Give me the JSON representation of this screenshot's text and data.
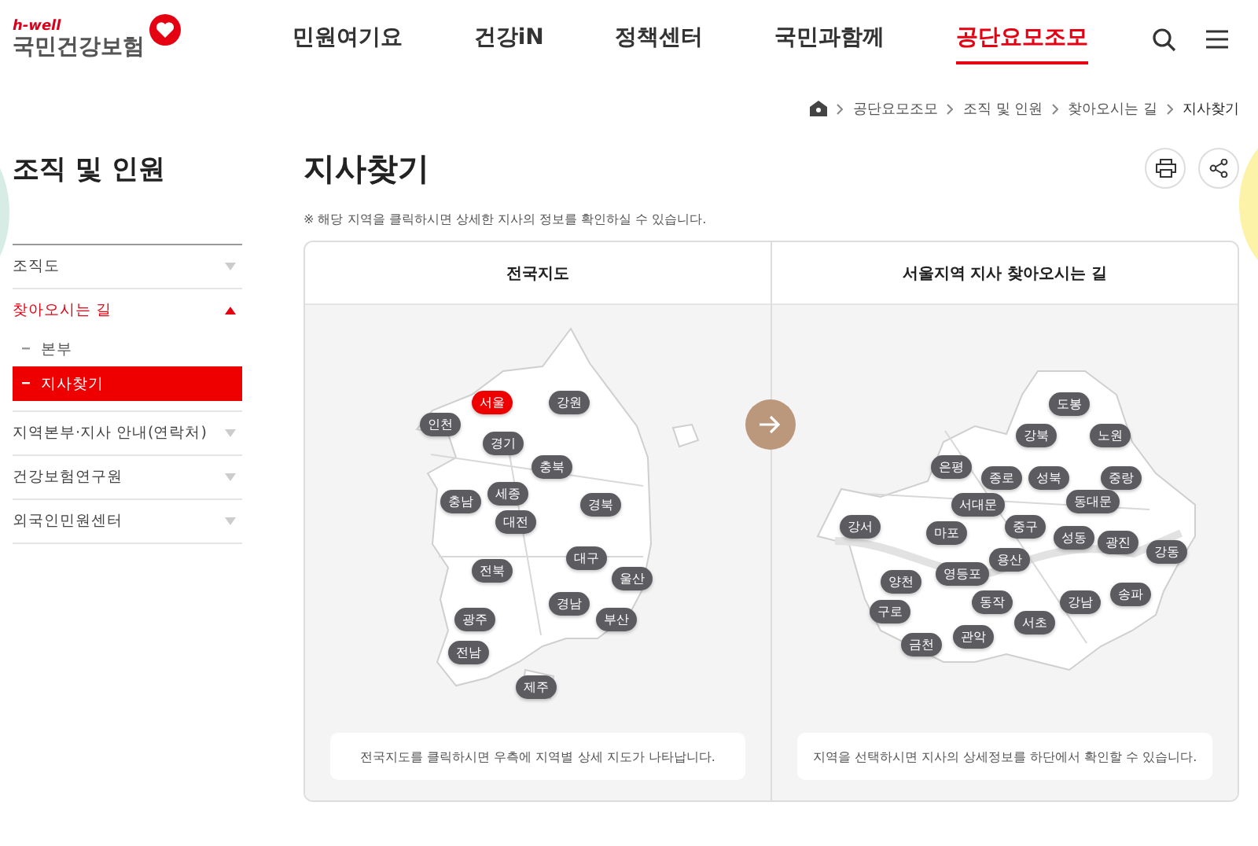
{
  "logo": {
    "tagline": "h-well",
    "name": "국민건강보험"
  },
  "nav": [
    {
      "label": "민원여기요",
      "selected": false
    },
    {
      "label": "건강iN",
      "selected": false
    },
    {
      "label": "정책센터",
      "selected": false
    },
    {
      "label": "국민과함께",
      "selected": false
    },
    {
      "label": "공단요모조모",
      "selected": true
    }
  ],
  "breadcrumb": [
    "공단요모조모",
    "조직 및 인원",
    "찾아오시는 길",
    "지사찾기"
  ],
  "sidebar": {
    "title": "조직 및 인원",
    "items": [
      {
        "label": "조직도",
        "expanded": false,
        "selected": false
      },
      {
        "label": "찾아오시는 길",
        "expanded": true,
        "selected": true,
        "children": [
          {
            "label": "본부",
            "selected": false
          },
          {
            "label": "지사찾기",
            "selected": true
          }
        ]
      },
      {
        "label": "지역본부·지사 안내(연락처)",
        "expanded": false,
        "selected": false
      },
      {
        "label": "건강보험연구원",
        "expanded": false,
        "selected": false
      },
      {
        "label": "외국인민원센터",
        "expanded": false,
        "selected": false
      }
    ]
  },
  "page": {
    "title": "지사찾기",
    "note": "※ 해당 지역을 클릭하시면 상세한 지사의 정보를 확인하실 수 있습니다."
  },
  "panels": [
    {
      "kind": "national",
      "heading": "전국지도",
      "caption": "전국지도를 클릭하시면 우측에 지역별 상세 지도가 나타납니다.",
      "regions": [
        {
          "label": "서울",
          "selected": true
        },
        {
          "label": "강원",
          "selected": false
        },
        {
          "label": "인천",
          "selected": false
        },
        {
          "label": "경기",
          "selected": false
        },
        {
          "label": "충북",
          "selected": false
        },
        {
          "label": "세종",
          "selected": false
        },
        {
          "label": "충남",
          "selected": false
        },
        {
          "label": "대전",
          "selected": false
        },
        {
          "label": "경북",
          "selected": false
        },
        {
          "label": "대구",
          "selected": false
        },
        {
          "label": "전북",
          "selected": false
        },
        {
          "label": "울산",
          "selected": false
        },
        {
          "label": "경남",
          "selected": false
        },
        {
          "label": "부산",
          "selected": false
        },
        {
          "label": "광주",
          "selected": false
        },
        {
          "label": "전남",
          "selected": false
        },
        {
          "label": "제주",
          "selected": false
        }
      ]
    },
    {
      "kind": "seoul",
      "heading": "서울지역 지사 찾아오시는 길",
      "caption": "지역을 선택하시면 지사의 상세정보를 하단에서 확인할 수 있습니다.",
      "regions": [
        {
          "label": "도봉",
          "selected": false
        },
        {
          "label": "강북",
          "selected": false
        },
        {
          "label": "노원",
          "selected": false
        },
        {
          "label": "은평",
          "selected": false
        },
        {
          "label": "종로",
          "selected": false
        },
        {
          "label": "성북",
          "selected": false
        },
        {
          "label": "중랑",
          "selected": false
        },
        {
          "label": "서대문",
          "selected": false
        },
        {
          "label": "동대문",
          "selected": false
        },
        {
          "label": "강서",
          "selected": false
        },
        {
          "label": "마포",
          "selected": false
        },
        {
          "label": "중구",
          "selected": false
        },
        {
          "label": "성동",
          "selected": false
        },
        {
          "label": "광진",
          "selected": false
        },
        {
          "label": "강동",
          "selected": false
        },
        {
          "label": "용산",
          "selected": false
        },
        {
          "label": "영등포",
          "selected": false
        },
        {
          "label": "양천",
          "selected": false
        },
        {
          "label": "송파",
          "selected": false
        },
        {
          "label": "강남",
          "selected": false
        },
        {
          "label": "동작",
          "selected": false
        },
        {
          "label": "구로",
          "selected": false
        },
        {
          "label": "서초",
          "selected": false
        },
        {
          "label": "관악",
          "selected": false
        },
        {
          "label": "금천",
          "selected": false
        }
      ]
    }
  ]
}
